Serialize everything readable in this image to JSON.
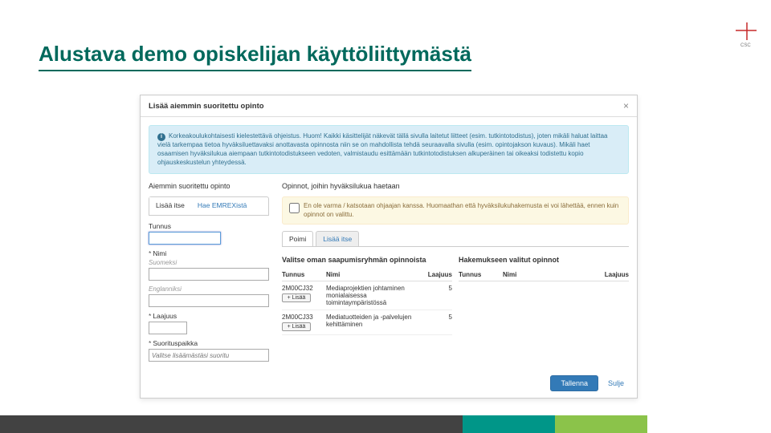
{
  "slide": {
    "title": "Alustava demo opiskelijan käyttöliittymästä",
    "logo_text": "CSC"
  },
  "dialog": {
    "title": "Lisää aiemmin suoritettu opinto",
    "close": "×",
    "info": "Korkeakoulukohtaisesti kielestettävä ohjeistus. Huom! Kaikki käsittelijät näkevät tällä sivulla laitetut liitteet (esim. tutkintotodistus), joten mikäli haluat laittaa vielä tarkempaa tietoa hyväksiluettavaksi anottavasta opinnosta niin se on mahdollista tehdä seuraavalla sivulla (esim. opintojakson kuvaus). Mikäli haet osaamisen hyväksilukua aiempaan tutkintotodistukseen vedoten, valmistaudu esittämään tutkintotodistuksen alkuperäinen tai oikeaksi todistettu kopio ohjauskeskustelun yhteydessä.",
    "left": {
      "heading": "Aiemmin suoritettu opinto",
      "tabs": [
        "Lisää itse",
        "Hae EMREXistä"
      ],
      "tunnus_label": "Tunnus",
      "nimi_label": "Nimi",
      "nimi_fi": "Suomeksi",
      "nimi_en": "Englanniksi",
      "laajuus_label": "Laajuus",
      "paikka_label": "Suorituspaikka",
      "paikka_placeholder": "Valitse lisäämästäsi suoritu"
    },
    "right": {
      "heading": "Opinnot, joihin hyväksilukua haetaan",
      "warn": "En ole varma / katsotaan ohjaajan kanssa. Huomaathan että hyväksilukuhakemusta ei voi lähettää, ennen kuin opinnot on valittu.",
      "mini_tabs": [
        "Poimi",
        "Lisää itse"
      ],
      "panel_left_title": "Valitse oman saapumisryhmän opinnoista",
      "panel_right_title": "Hakemukseen valitut opinnot",
      "cols": {
        "tunnus": "Tunnus",
        "nimi": "Nimi",
        "laajuus": "Laajuus"
      },
      "add_btn": "+ Lisää",
      "rows": [
        {
          "tunnus": "2M00CJ32",
          "nimi": "Mediaprojektien johtaminen monialaisessa toimintaympäristössä",
          "laajuus": "5"
        },
        {
          "tunnus": "2M00CJ33",
          "nimi": "Mediatuotteiden ja -palvelujen kehittäminen",
          "laajuus": "5"
        }
      ]
    },
    "footer": {
      "save": "Tallenna",
      "close": "Sulje"
    }
  },
  "colors": {
    "teal": "#009688",
    "dkteal": "#00695c",
    "green": "#8bc34a",
    "cyan": "#00bcd4",
    "grey": "#424242"
  }
}
